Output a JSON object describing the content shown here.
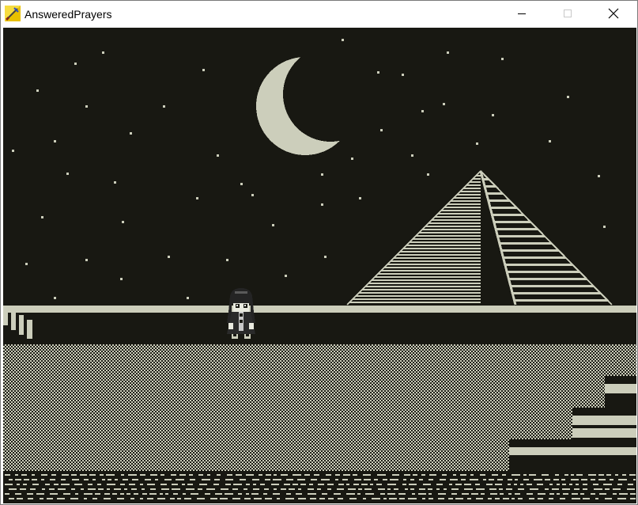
{
  "window": {
    "title": "AnsweredPrayers",
    "controls": [
      "minimize",
      "maximize",
      "close"
    ]
  },
  "scene": {
    "palette": {
      "night": "#181812",
      "light": "#cccebb",
      "dither_dark": "#1e1e17"
    },
    "elements": [
      "starry-sky",
      "crescent-moon",
      "pyramid",
      "horizon-line",
      "steps",
      "dithered-ground",
      "staircase",
      "water"
    ],
    "character": "girl-with-dark-hair"
  }
}
